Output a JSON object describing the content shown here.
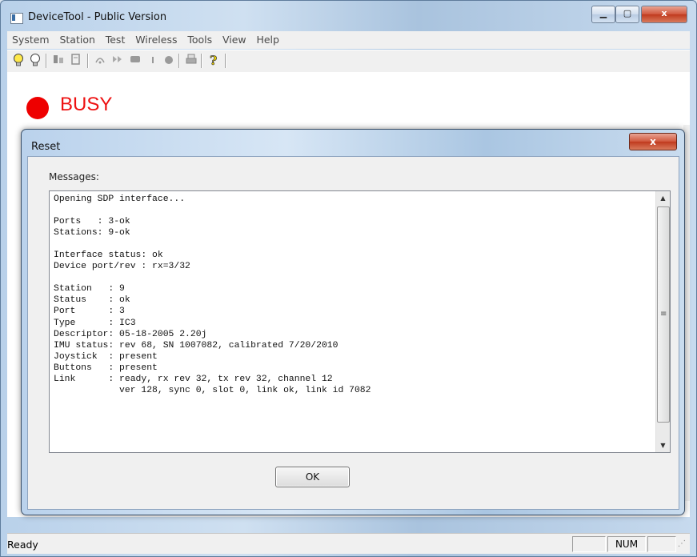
{
  "window": {
    "title": "DeviceTool - Public Version"
  },
  "window_controls": {
    "minimize": "▁",
    "maximize": "▢",
    "close": "x"
  },
  "menu": [
    "System",
    "Station",
    "Test",
    "Wireless",
    "Tools",
    "View",
    "Help"
  ],
  "toolbar": {
    "icons": [
      "bulb-on-icon",
      "bulb-off-icon",
      "tool-1-icon",
      "tool-2-icon",
      "signal-icon",
      "forward-icon",
      "device-icon",
      "marker-icon",
      "record-icon",
      "print-icon",
      "help-icon"
    ]
  },
  "status_panel": {
    "busy_label": "BUSY",
    "busy_color": "#ee0000"
  },
  "dialog": {
    "title": "Reset",
    "close_label": "x",
    "messages_label": "Messages:",
    "messages_text": "Opening SDP interface...\n\nPorts   : 3-ok\nStations: 9-ok\n\nInterface status: ok\nDevice port/rev : rx=3/32\n\nStation   : 9\nStatus    : ok\nPort      : 3\nType      : IC3\nDescriptor: 05-18-2005 2.20j\nIMU status: rev 68, SN 1007082, calibrated 7/20/2010\nJoystick  : present\nButtons   : present\nLink      : ready, rx rev 32, tx rev 32, channel 12\n            ver 128, sync 0, slot 0, link ok, link id 7082",
    "ok_label": "OK"
  },
  "statusbar": {
    "ready": "Ready",
    "num": "NUM"
  }
}
